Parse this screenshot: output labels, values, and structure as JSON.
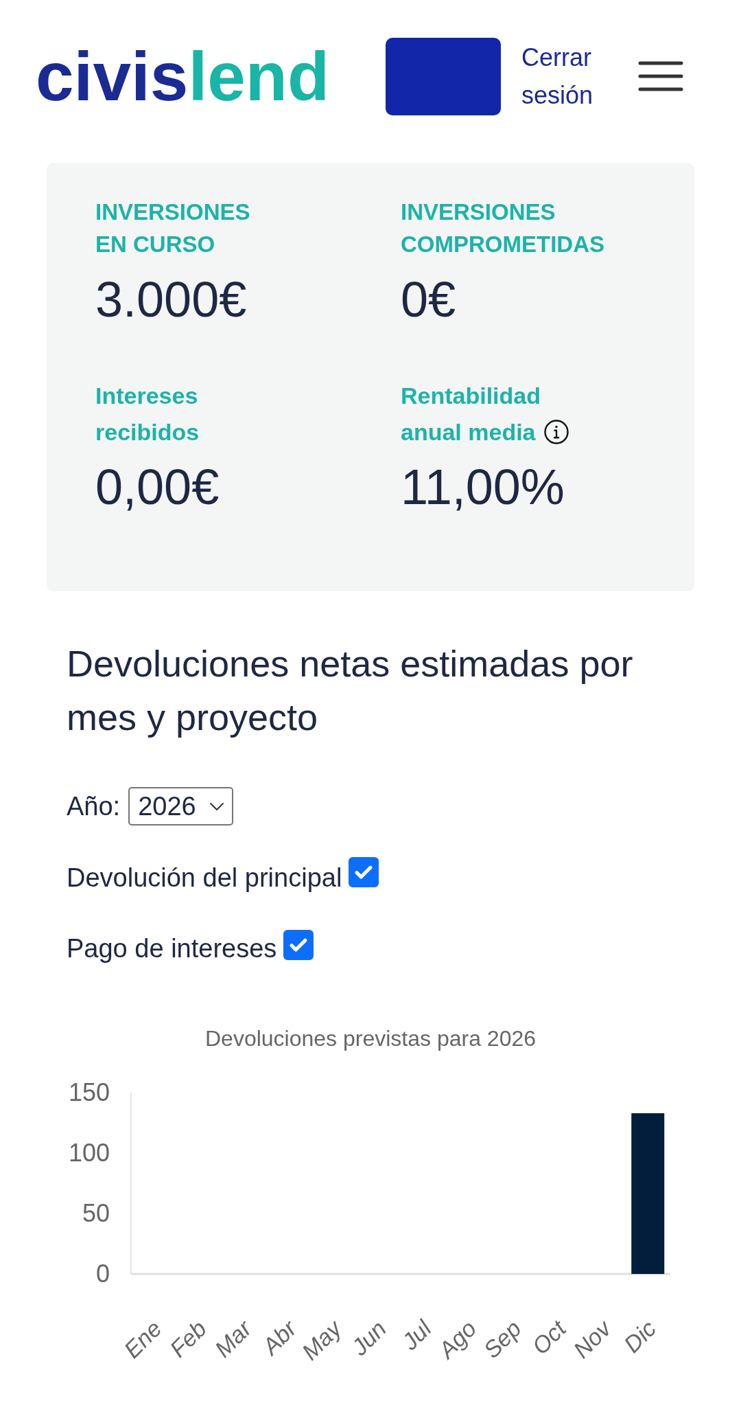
{
  "header": {
    "logo": {
      "first": "civis",
      "second": "lend"
    },
    "logout_link": "Cerrar sesión"
  },
  "stats": [
    {
      "kind": "caps",
      "label": "INVERSIONES EN CURSO",
      "value": "3.000€",
      "info_icon": false
    },
    {
      "kind": "caps",
      "label": "INVERSIONES COMPROMETIDAS",
      "value": "0€",
      "info_icon": false
    },
    {
      "kind": "plain",
      "label": "Intereses recibidos",
      "value": "0,00€",
      "info_icon": false
    },
    {
      "kind": "plain",
      "label": "Rentabilidad anual media",
      "value": "11,00%",
      "info_icon": true
    }
  ],
  "returns": {
    "title": "Devoluciones netas estimadas por mes y proyecto",
    "year_label": "Año:",
    "year_select": {
      "value": "2026"
    },
    "options": [
      {
        "label": "Devolución del principal",
        "checked": true
      },
      {
        "label": "Pago de intereses",
        "checked": true
      }
    ],
    "chart_data": {
      "type": "bar",
      "title": "Devoluciones previstas para 2026",
      "categories": [
        "Ene",
        "Feb",
        "Mar",
        "Abr",
        "May",
        "Jun",
        "Jul",
        "Ago",
        "Sep",
        "Oct",
        "Nov",
        "Dic"
      ],
      "values": [
        0,
        0,
        0,
        0,
        0,
        0,
        0,
        0,
        0,
        0,
        0,
        133
      ],
      "ylim": [
        0,
        150
      ],
      "yticks": [
        0,
        50,
        100,
        150
      ]
    }
  }
}
